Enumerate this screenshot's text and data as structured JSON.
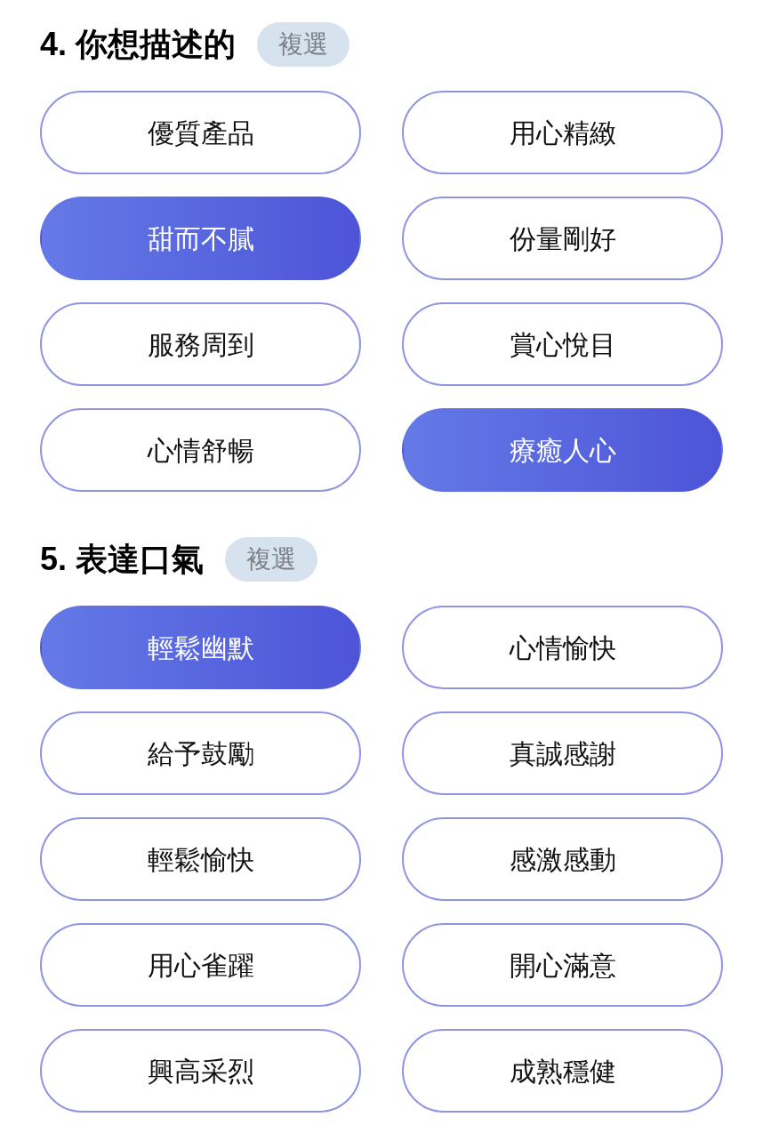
{
  "sections": [
    {
      "title": "4. 你想描述的",
      "badge": "複選",
      "options": [
        {
          "label": "優質產品",
          "selected": false
        },
        {
          "label": "用心精緻",
          "selected": false
        },
        {
          "label": "甜而不膩",
          "selected": true
        },
        {
          "label": "份量剛好",
          "selected": false
        },
        {
          "label": "服務周到",
          "selected": false
        },
        {
          "label": "賞心悅目",
          "selected": false
        },
        {
          "label": "心情舒暢",
          "selected": false
        },
        {
          "label": "療癒人心",
          "selected": true
        }
      ]
    },
    {
      "title": "5. 表達口氣",
      "badge": "複選",
      "options": [
        {
          "label": "輕鬆幽默",
          "selected": true
        },
        {
          "label": "心情愉快",
          "selected": false
        },
        {
          "label": "給予鼓勵",
          "selected": false
        },
        {
          "label": "真誠感謝",
          "selected": false
        },
        {
          "label": "輕鬆愉快",
          "selected": false
        },
        {
          "label": "感激感動",
          "selected": false
        },
        {
          "label": "用心雀躍",
          "selected": false
        },
        {
          "label": "開心滿意",
          "selected": false
        },
        {
          "label": "興高采烈",
          "selected": false
        },
        {
          "label": "成熟穩健",
          "selected": false
        }
      ]
    }
  ]
}
